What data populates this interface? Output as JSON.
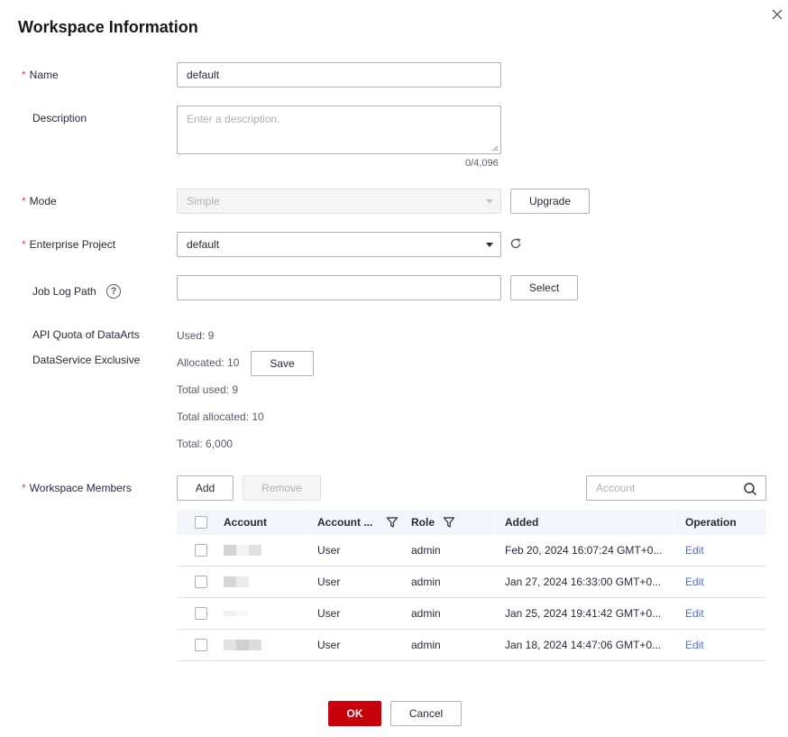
{
  "dialog": {
    "title": "Workspace Information"
  },
  "form": {
    "name": {
      "label": "Name",
      "value": "default"
    },
    "description": {
      "label": "Description",
      "placeholder": "Enter a description.",
      "counter": "0/4,096"
    },
    "mode": {
      "label": "Mode",
      "value": "Simple",
      "upgrade_label": "Upgrade"
    },
    "enterprise_project": {
      "label": "Enterprise Project",
      "value": "default"
    },
    "job_log_path": {
      "label": "Job Log Path",
      "value": "",
      "select_label": "Select"
    },
    "api_quota": {
      "label_line1": "API Quota of DataArts",
      "label_line2": "DataService Exclusive",
      "used": "Used: 9",
      "allocated": "Allocated: 10",
      "save_label": "Save",
      "total_used": "Total used: 9",
      "total_allocated": "Total allocated: 10",
      "total": "Total: 6,000"
    },
    "members": {
      "label": "Workspace Members",
      "add_label": "Add",
      "remove_label": "Remove",
      "search_placeholder": "Account"
    }
  },
  "table": {
    "headers": {
      "account": "Account",
      "account_type": "Account ...",
      "role": "Role",
      "added": "Added",
      "operation": "Operation"
    },
    "rows": [
      {
        "account_type": "User",
        "role": "admin",
        "added": "Feb 20, 2024 16:07:24 GMT+0...",
        "operation": "Edit"
      },
      {
        "account_type": "User",
        "role": "admin",
        "added": "Jan 27, 2024 16:33:00 GMT+0...",
        "operation": "Edit"
      },
      {
        "account_type": "User",
        "role": "admin",
        "added": "Jan 25, 2024 19:41:42 GMT+0...",
        "operation": "Edit"
      },
      {
        "account_type": "User",
        "role": "admin",
        "added": "Jan 18, 2024 14:47:06 GMT+0...",
        "operation": "Edit"
      }
    ]
  },
  "footer": {
    "ok_label": "OK",
    "cancel_label": "Cancel"
  },
  "icons": {
    "close": "close-icon",
    "refresh": "refresh-icon",
    "help": "help-icon",
    "search": "search-icon",
    "filter": "filter-icon",
    "dropdown": "chevron-down-icon"
  },
  "colors": {
    "primary": "#c7000b",
    "link": "#526ecc",
    "required": "#e54545",
    "header_bg": "#f2f5fc"
  }
}
